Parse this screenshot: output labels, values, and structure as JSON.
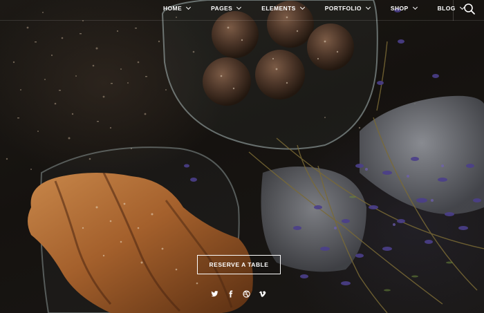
{
  "nav": {
    "items": [
      {
        "label": "HOME",
        "icon": "chevron-down-icon"
      },
      {
        "label": "PAGES",
        "icon": "chevron-down-icon"
      },
      {
        "label": "ELEMENTS",
        "icon": "chevron-down-icon"
      },
      {
        "label": "PORTFOLIO",
        "icon": "chevron-down-icon"
      },
      {
        "label": "SHOP",
        "icon": "chevron-down-icon"
      },
      {
        "label": "BLOG",
        "icon": "chevron-down-icon"
      }
    ],
    "search_icon": "search-icon"
  },
  "hero": {
    "cta_label": "RESERVE A TABLE"
  },
  "social": {
    "icons": [
      "twitter-icon",
      "facebook-icon",
      "dribbble-icon",
      "vimeo-icon"
    ]
  },
  "colors": {
    "text": "#ffffff",
    "background": "#141210",
    "accent_flowers": "#4b3f8a"
  }
}
